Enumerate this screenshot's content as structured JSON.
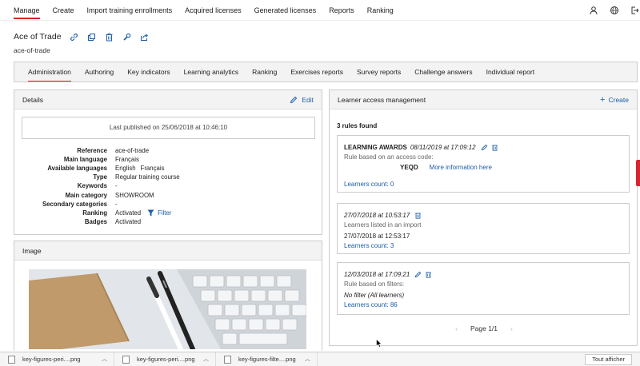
{
  "topnav": {
    "items": [
      {
        "label": "Manage"
      },
      {
        "label": "Create"
      },
      {
        "label": "Import training enrollments"
      },
      {
        "label": "Acquired licenses"
      },
      {
        "label": "Generated licenses"
      },
      {
        "label": "Reports"
      },
      {
        "label": "Ranking"
      }
    ],
    "icons": [
      "user-icon",
      "globe-icon",
      "logout-icon"
    ]
  },
  "course": {
    "title": "Ace of Trade",
    "slug": "ace-of-trade"
  },
  "tabs": [
    {
      "label": "Administration"
    },
    {
      "label": "Authoring"
    },
    {
      "label": "Key indicators"
    },
    {
      "label": "Learning analytics"
    },
    {
      "label": "Ranking"
    },
    {
      "label": "Exercises reports"
    },
    {
      "label": "Survey reports"
    },
    {
      "label": "Challenge answers"
    },
    {
      "label": "Individual report"
    }
  ],
  "details": {
    "title": "Details",
    "edit_label": "Edit",
    "published": "Last published on 25/06/2018 at 10:46:10",
    "fields": {
      "reference": {
        "key": "Reference",
        "value": "ace-of-trade"
      },
      "main_language": {
        "key": "Main language",
        "value": "Français"
      },
      "available_languages": {
        "key": "Available languages",
        "value1": "English",
        "value2": "Français"
      },
      "type": {
        "key": "Type",
        "value": "Regular training course"
      },
      "keywords": {
        "key": "Keywords",
        "value": "-"
      },
      "main_category": {
        "key": "Main category",
        "value": "SHOWROOM"
      },
      "secondary_categories": {
        "key": "Secondary categories",
        "value": "-"
      },
      "ranking": {
        "key": "Ranking",
        "value": "Activated",
        "filter_label": "Filter"
      },
      "badges": {
        "key": "Badges",
        "value": "Activated"
      }
    }
  },
  "image_panel": {
    "title": "Image"
  },
  "access": {
    "title": "Learner access management",
    "create_label": "Create",
    "rules_found": "3 rules found",
    "rules": [
      {
        "title": "LEARNING AWARDS",
        "date": "08/11/2019 at 17:09:12",
        "desc": "Rule based on an access code:",
        "code": "YEQD",
        "more_info": "More information here",
        "count": "Learners count: 0"
      },
      {
        "date": "27/07/2018 at 10:53:17",
        "desc": "Learners listed in an import",
        "detail": "27/07/2018 at 12:53:17",
        "count": "Learners count: 3"
      },
      {
        "date": "12/03/2018 at 17:09:21",
        "desc": "Rule based on filters:",
        "detail": "No filter (All learners)",
        "count": "Learners count: 86"
      }
    ],
    "pager": "Page 1/1"
  },
  "downloads": {
    "items": [
      {
        "name": "key-figures-peri....png"
      },
      {
        "name": "key-figures-peri....png"
      },
      {
        "name": "key-figures-filte....png"
      }
    ],
    "show_all": "Tout afficher"
  },
  "colors": {
    "accent": "#d9232d",
    "link": "#1a5ea8"
  }
}
